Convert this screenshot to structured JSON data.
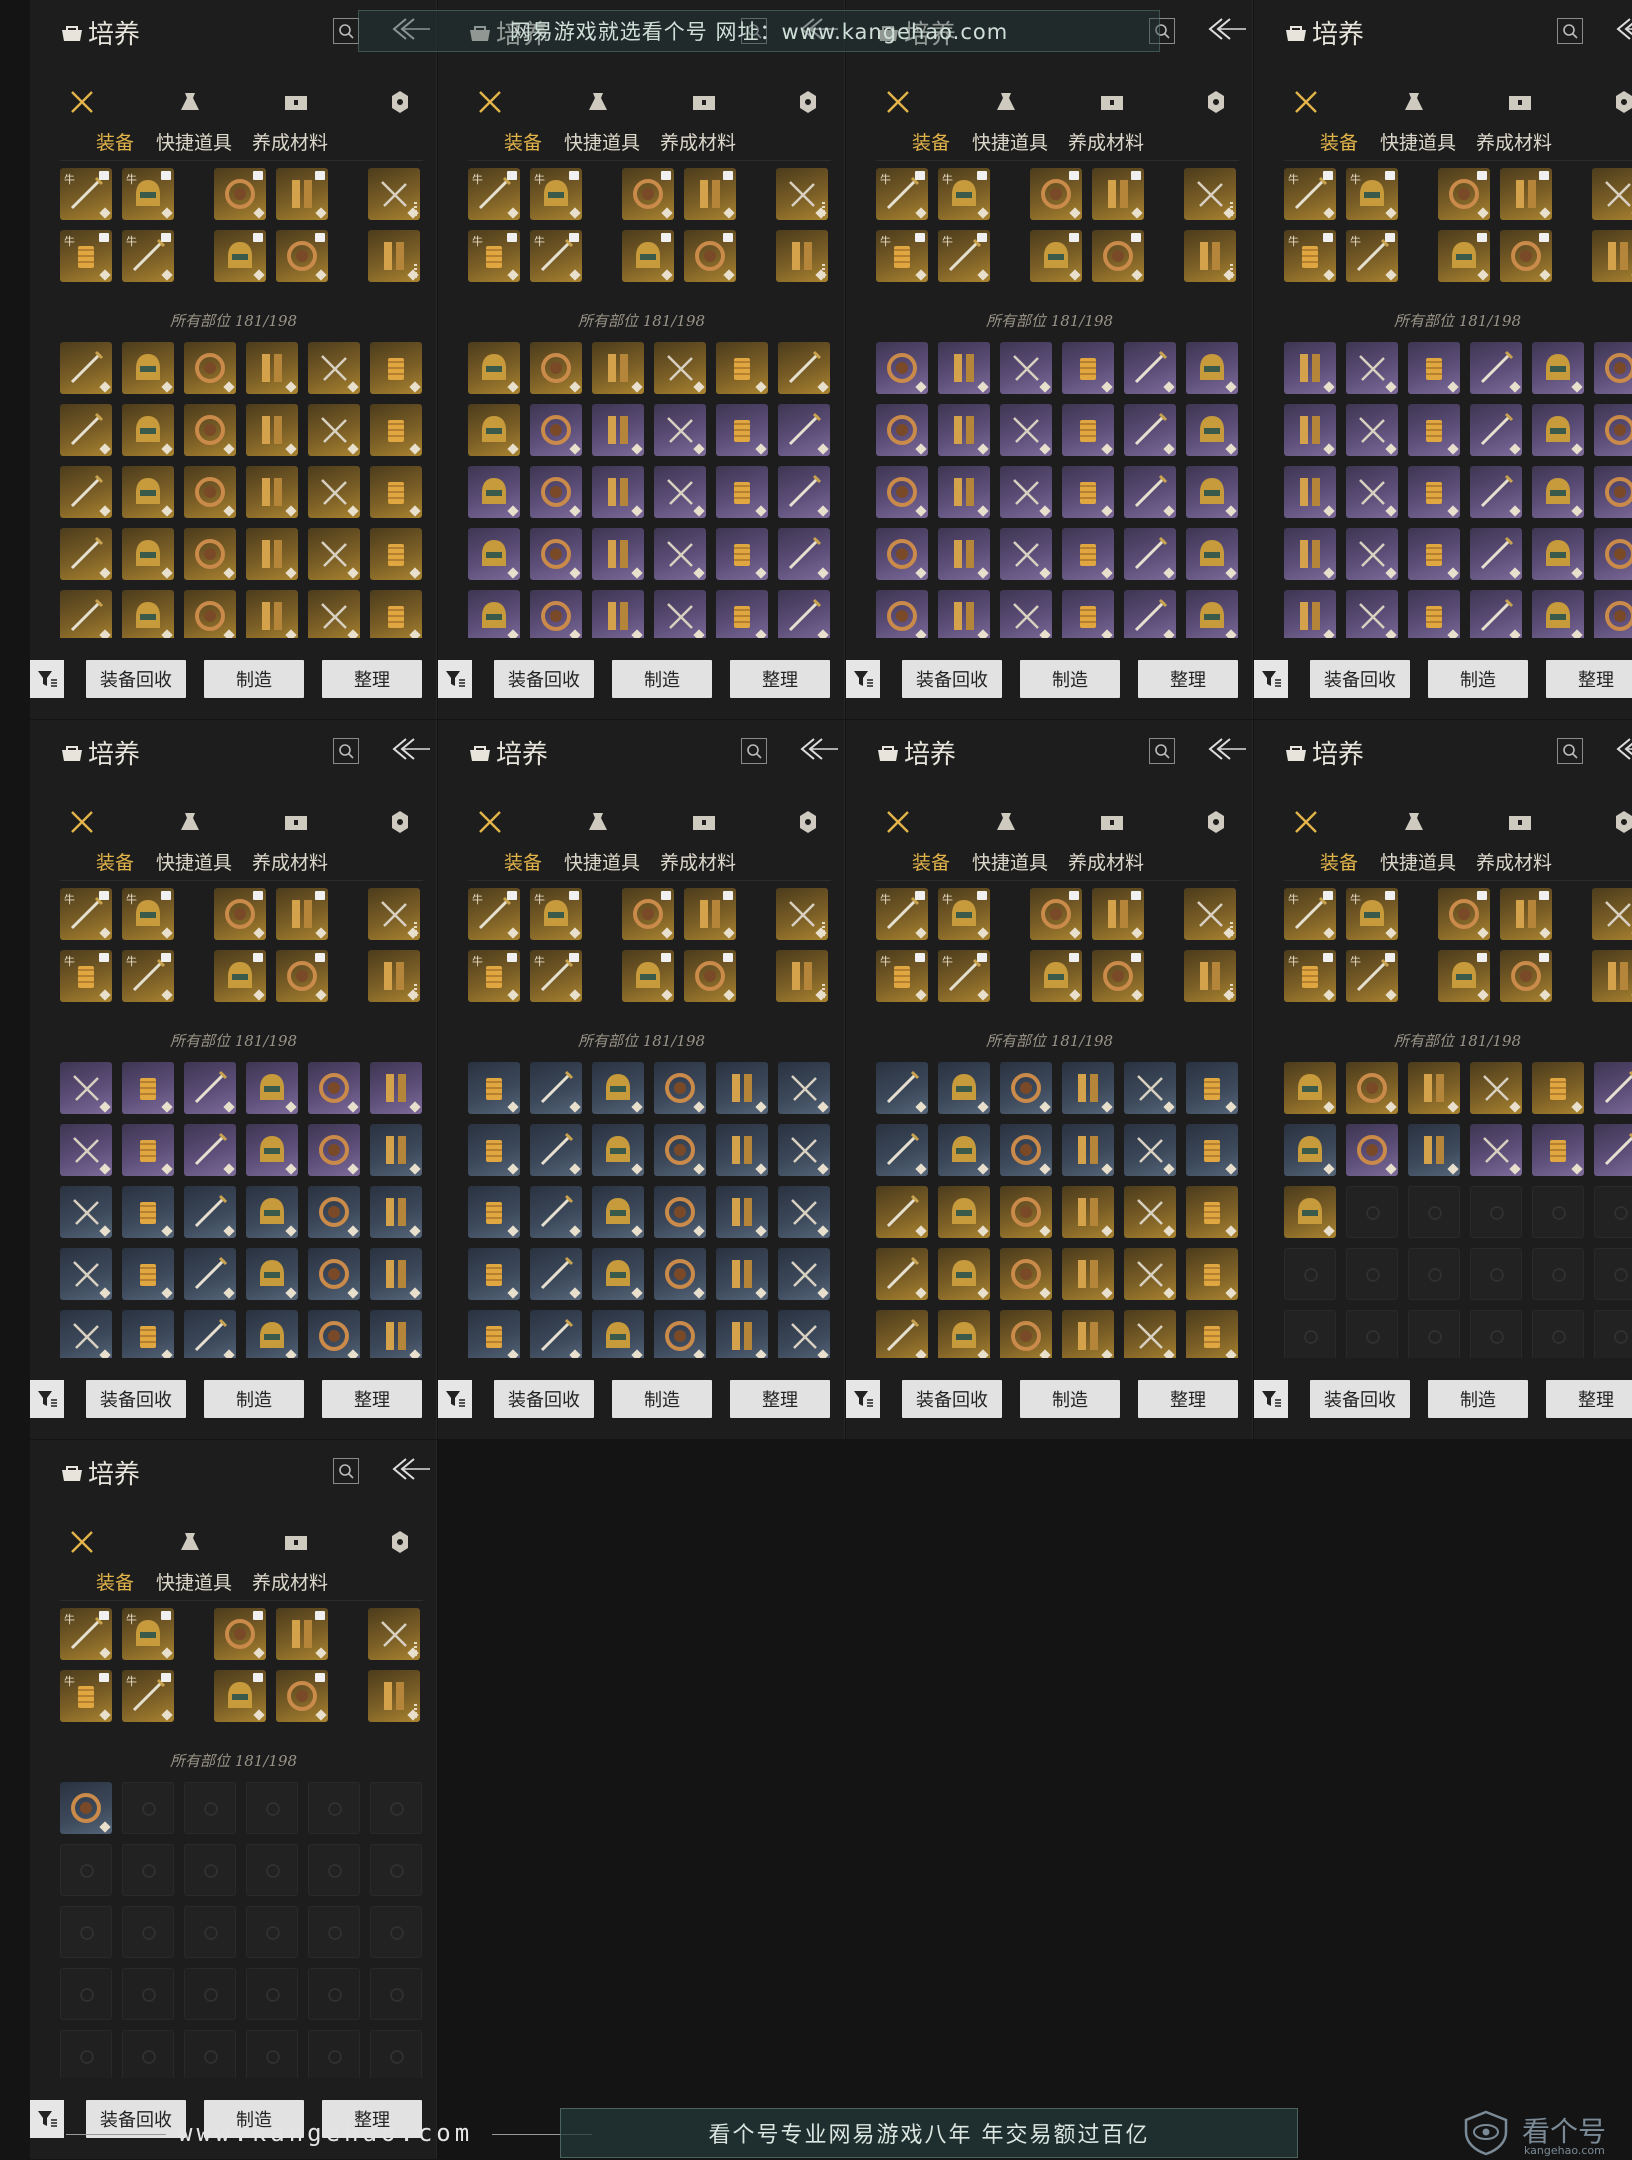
{
  "app": {
    "title": "培养",
    "tabs": [
      "装备",
      "快捷道具",
      "养成材料"
    ],
    "active_tab": "装备",
    "category_icons": [
      "weapon-icon",
      "consumable-pouch-icon",
      "chest-icon",
      "material-icon"
    ],
    "capacity_label": "所有部位 181/198",
    "buttons": {
      "recycle": "装备回收",
      "craft": "制造",
      "sort": "整理"
    }
  },
  "colors": {
    "accent": "#e2b44a",
    "gold": "#a9832f",
    "purple": "#7d6a9a",
    "blue": "#566579"
  },
  "panels": [
    {
      "equip_top": [
        [
          "牛",
          "牛",
          "",
          "",
          "",
          ""
        ],
        [
          "牛",
          "牛",
          "",
          "",
          "",
          ""
        ]
      ],
      "inventory": [
        [
          "gold",
          "gold",
          "gold",
          "gold",
          "gold",
          "gold"
        ],
        [
          "gold",
          "gold",
          "gold",
          "gold",
          "gold",
          "gold"
        ],
        [
          "gold",
          "gold",
          "gold",
          "gold",
          "gold",
          "gold"
        ],
        [
          "gold",
          "gold",
          "gold",
          "gold",
          "gold",
          "gold"
        ],
        [
          "gold",
          "gold",
          "gold",
          "gold",
          "gold",
          "gold"
        ]
      ]
    },
    {
      "equip_top": [
        [
          "牛",
          "牛",
          "",
          "",
          "",
          ""
        ],
        [
          "牛",
          "牛",
          "",
          "",
          "",
          ""
        ]
      ],
      "inventory": [
        [
          "gold",
          "gold",
          "gold",
          "gold",
          "gold",
          "gold"
        ],
        [
          "gold",
          "purple",
          "purple",
          "purple",
          "purple",
          "purple"
        ],
        [
          "purple",
          "purple",
          "purple",
          "purple",
          "purple",
          "purple"
        ],
        [
          "purple",
          "purple",
          "purple",
          "purple",
          "purple",
          "purple"
        ],
        [
          "purple",
          "purple",
          "purple",
          "purple",
          "purple",
          "purple"
        ]
      ]
    },
    {
      "equip_top": [
        [
          "牛",
          "牛",
          "",
          "",
          "",
          ""
        ],
        [
          "牛",
          "牛",
          "",
          "",
          "",
          ""
        ]
      ],
      "inventory": [
        [
          "purple",
          "purple",
          "purple",
          "purple",
          "purple",
          "purple"
        ],
        [
          "purple",
          "purple",
          "purple",
          "purple",
          "purple",
          "purple"
        ],
        [
          "purple",
          "purple",
          "purple",
          "purple",
          "purple",
          "purple"
        ],
        [
          "purple",
          "purple",
          "purple",
          "purple",
          "purple",
          "purple"
        ],
        [
          "purple",
          "purple",
          "purple",
          "purple",
          "purple",
          "purple"
        ]
      ]
    },
    {
      "equip_top": [
        [
          "牛",
          "牛",
          "",
          "",
          "",
          ""
        ],
        [
          "牛",
          "牛",
          "",
          "",
          "",
          ""
        ]
      ],
      "inventory": [
        [
          "purple",
          "purple",
          "purple",
          "purple",
          "purple",
          "purple"
        ],
        [
          "purple",
          "purple",
          "purple",
          "purple",
          "purple",
          "purple"
        ],
        [
          "purple",
          "purple",
          "purple",
          "purple",
          "purple",
          "purple"
        ],
        [
          "purple",
          "purple",
          "purple",
          "purple",
          "purple",
          "purple"
        ],
        [
          "purple",
          "purple",
          "purple",
          "purple",
          "purple",
          "purple"
        ]
      ]
    },
    {
      "equip_top": [
        [
          "牛",
          "牛",
          "",
          "",
          "",
          ""
        ],
        [
          "牛",
          "牛",
          "",
          "",
          "",
          ""
        ]
      ],
      "inventory": [
        [
          "purple",
          "purple",
          "purple",
          "purple",
          "purple",
          "purple"
        ],
        [
          "purple",
          "purple",
          "purple",
          "purple",
          "purple",
          "blue"
        ],
        [
          "blue",
          "blue",
          "blue",
          "blue",
          "blue",
          "blue"
        ],
        [
          "blue",
          "blue",
          "blue",
          "blue",
          "blue",
          "blue"
        ],
        [
          "blue",
          "blue",
          "blue",
          "blue",
          "blue",
          "blue"
        ]
      ]
    },
    {
      "equip_top": [
        [
          "牛",
          "牛",
          "",
          "",
          "",
          ""
        ],
        [
          "牛",
          "牛",
          "",
          "",
          "",
          ""
        ]
      ],
      "inventory": [
        [
          "blue",
          "blue",
          "blue",
          "blue",
          "blue",
          "blue"
        ],
        [
          "blue",
          "blue",
          "blue",
          "blue",
          "blue",
          "blue"
        ],
        [
          "blue",
          "blue",
          "blue",
          "blue",
          "blue",
          "blue"
        ],
        [
          "blue",
          "blue",
          "blue",
          "blue",
          "blue",
          "blue"
        ],
        [
          "blue",
          "blue",
          "blue",
          "blue",
          "blue",
          "blue"
        ]
      ]
    },
    {
      "equip_top": [
        [
          "牛",
          "牛",
          "",
          "",
          "",
          ""
        ],
        [
          "牛",
          "牛",
          "",
          "",
          "",
          ""
        ]
      ],
      "inventory": [
        [
          "blue",
          "blue",
          "blue",
          "blue",
          "blue",
          "blue"
        ],
        [
          "blue",
          "blue",
          "blue",
          "blue",
          "blue",
          "blue"
        ],
        [
          "gold",
          "gold",
          "gold",
          "gold",
          "gold",
          "gold"
        ],
        [
          "gold",
          "gold",
          "gold",
          "gold",
          "gold",
          "gold"
        ],
        [
          "gold",
          "gold",
          "gold",
          "gold",
          "gold",
          "gold"
        ]
      ]
    },
    {
      "equip_top": [
        [
          "牛",
          "牛",
          "",
          "",
          "",
          ""
        ],
        [
          "牛",
          "牛",
          "",
          "",
          "",
          ""
        ]
      ],
      "inventory": [
        [
          "gold",
          "gold",
          "gold",
          "gold",
          "gold",
          "purple"
        ],
        [
          "blue",
          "purple",
          "blue",
          "purple",
          "purple",
          "purple"
        ],
        [
          "gold",
          "empty",
          "empty",
          "empty",
          "empty",
          "empty"
        ],
        [
          "empty",
          "empty",
          "empty",
          "empty",
          "empty",
          "empty"
        ],
        [
          "empty",
          "empty",
          "empty",
          "empty",
          "empty",
          "empty"
        ]
      ]
    },
    {
      "equip_top": [
        [
          "牛",
          "牛",
          "",
          "",
          "",
          ""
        ],
        [
          "牛",
          "牛",
          "",
          "",
          "",
          ""
        ]
      ],
      "inventory": [
        [
          "blue",
          "empty",
          "empty",
          "empty",
          "empty",
          "empty"
        ],
        [
          "empty",
          "empty",
          "empty",
          "empty",
          "empty",
          "empty"
        ],
        [
          "empty",
          "empty",
          "empty",
          "empty",
          "empty",
          "empty"
        ],
        [
          "lockd",
          "lockd",
          "lockd",
          "lockd",
          "lockd",
          "lockd"
        ],
        [
          "lockd",
          "lockd",
          "lockd",
          "lockd",
          "lockd",
          "lockd"
        ]
      ]
    }
  ],
  "watermark": {
    "top": "网易游戏就选看个号  网址：www.kangehao.com",
    "url": "www.kangehao.com",
    "slogan": "看个号专业网易游戏八年   年交易额过百亿",
    "logo_text": "看个号",
    "logo_sub": "kangehao.com"
  }
}
